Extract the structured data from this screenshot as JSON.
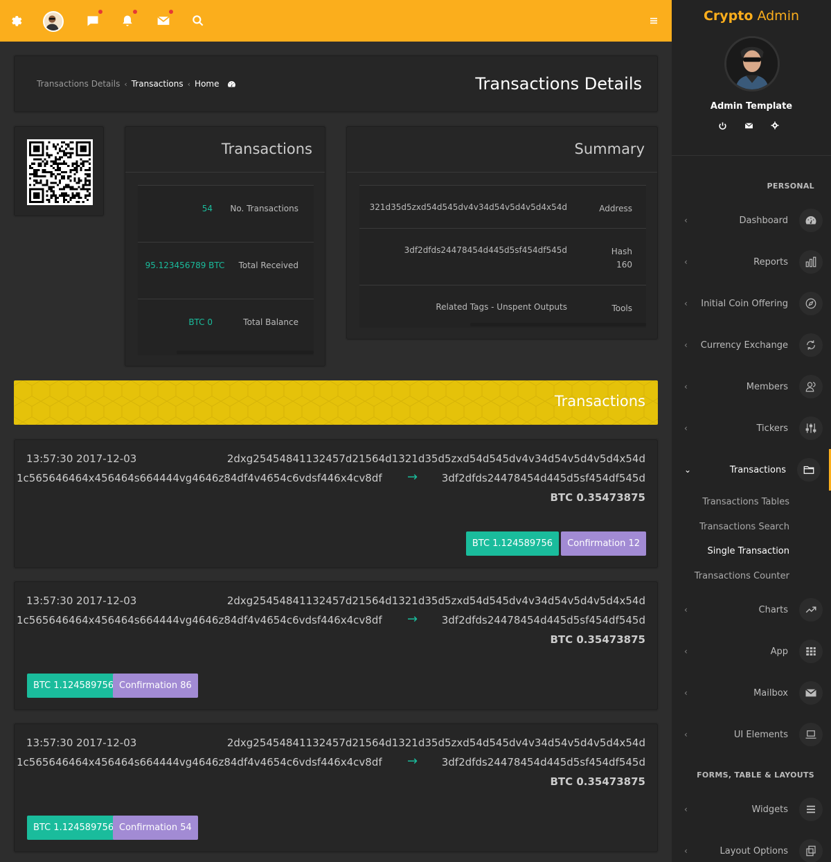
{
  "topbar": {
    "icons": [
      "gear-icon",
      "avatar",
      "chat-icon",
      "bell-icon",
      "mail-icon",
      "search-icon",
      "menu-icon"
    ]
  },
  "breadcrumb": {
    "items": [
      "Transactions Details",
      "Transactions",
      "Home"
    ],
    "home_icon": "dashboard-icon"
  },
  "page_title": "Transactions Details",
  "transactions_box": {
    "title": "Transactions",
    "rows": [
      {
        "value": "54",
        "label": "No. Transactions"
      },
      {
        "value": "95.123456789 BTC",
        "label": "Total Received"
      },
      {
        "value": "BTC 0",
        "label": "Total Balance"
      }
    ]
  },
  "summary_box": {
    "title": "Summary",
    "rows": [
      {
        "value": "321d35d5zxd54d545dv4v34d54v5d4v5d4x54d",
        "label": "Address"
      },
      {
        "value": "3df2dfds24478454d445d5sf454df545d",
        "label": "Hash 160"
      },
      {
        "value": "Related Tags - Unspent Outputs",
        "label": "Tools"
      }
    ]
  },
  "banner_title": "Transactions",
  "transactions": [
    {
      "time": "13:57:30 2017-12-03",
      "hash": "2dxg25454841132457d21564d1321d35d5zxd54d545dv4v34d54v5d4v5d4x54d",
      "from": "1c565646464x456464s664444vg4646z84df4v4654c6vdsf446x4cv8df",
      "arrow": "→",
      "to": "3df2dfds24478454d445d5sf454df545d",
      "amount": "BTC 0.35473875",
      "btc_badge": "BTC 1.124589756",
      "confirmation_badge": "Confirmation 12",
      "badge_align": "right"
    },
    {
      "time": "13:57:30 2017-12-03",
      "hash": "2dxg25454841132457d21564d1321d35d5zxd54d545dv4v34d54v5d4v5d4x54d",
      "from": "1c565646464x456464s664444vg4646z84df4v4654c6vdsf446x4cv8df",
      "arrow": "→",
      "to": "3df2dfds24478454d445d5sf454df545d",
      "amount": "BTC 0.35473875",
      "btc_badge": "BTC 1.124589756",
      "confirmation_badge": "Confirmation 86",
      "badge_align": "left"
    },
    {
      "time": "13:57:30 2017-12-03",
      "hash": "2dxg25454841132457d21564d1321d35d5zxd54d545dv4v34d54v5d4v5d4x54d",
      "from": "1c565646464x456464s664444vg4646z84df4v4654c6vdsf446x4cv8df",
      "arrow": "→",
      "to": "3df2dfds24478454d445d5sf454df545d",
      "amount": "BTC 0.35473875",
      "btc_badge": "BTC 1.124589756",
      "confirmation_badge": "Confirmation 54",
      "badge_align": "left"
    }
  ],
  "sidebar": {
    "brand_bold": "Crypto",
    "brand_light": " Admin",
    "profile_name": "Admin Template",
    "header_personal": "PERSONAL",
    "header_forms": "FORMS, TABLE & LAYOUTS",
    "items": [
      {
        "label": "Dashboard",
        "icon": "dashboard-icon"
      },
      {
        "label": "Reports",
        "icon": "bar-chart-icon"
      },
      {
        "label": "Initial Coin Offering",
        "icon": "compass-icon"
      },
      {
        "label": "Currency Exchange",
        "icon": "refresh-icon"
      },
      {
        "label": "Members",
        "icon": "users-icon"
      },
      {
        "label": "Tickers",
        "icon": "sliders-icon"
      },
      {
        "label": "Transactions",
        "icon": "folder-icon"
      }
    ],
    "sub_items": [
      "Transactions Tables",
      "Transactions Search",
      "Single Transaction",
      "Transactions Counter"
    ],
    "items_after": [
      {
        "label": "Charts",
        "icon": "line-chart-icon"
      },
      {
        "label": "App",
        "icon": "grid-icon"
      },
      {
        "label": "Mailbox",
        "icon": "mail-icon"
      },
      {
        "label": "UI Elements",
        "icon": "laptop-icon"
      }
    ],
    "items_forms": [
      {
        "label": "Widgets",
        "icon": "list-icon"
      },
      {
        "label": "Layout Options",
        "icon": "copy-icon"
      }
    ]
  },
  "colors": {
    "accent": "#fbae1c",
    "banner": "#e5c20a",
    "green": "#1abc9c",
    "purple": "#a28bd4"
  }
}
